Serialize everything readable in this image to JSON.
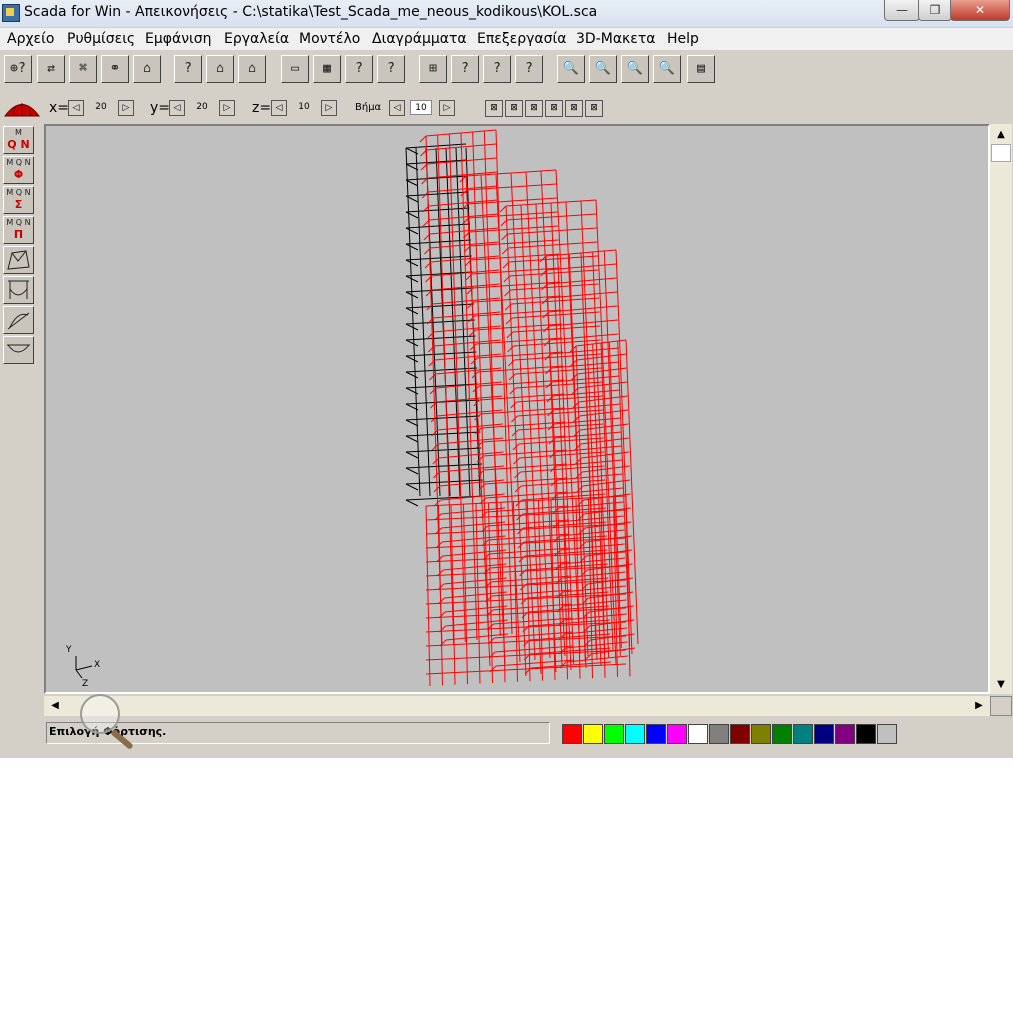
{
  "window": {
    "title": "Scada for Win - Απεικονήσεις - C:\\statika\\Test_Scada_me_neous_kodikous\\KOL.sca",
    "controls": {
      "minimize": "—",
      "restore": "❐",
      "close": "✕"
    }
  },
  "menu": {
    "items": [
      "Αρχείο",
      "Ρυθμίσεις",
      "Εμφάνιση",
      "Εργαλεία",
      "Μοντέλο",
      "Διαγράμματα",
      "Επεξεργασία",
      "3D-Μακετα",
      "Help"
    ]
  },
  "toolbar": {
    "buttons": [
      "⊕?",
      "⇄",
      "⌘",
      "⚭",
      "⌂",
      "?",
      "⌂",
      "⌂",
      "▭",
      "▦",
      "?",
      "?",
      "⊞",
      "?",
      "?",
      "?",
      "🔍",
      "🔍",
      "🔍",
      "🔍",
      "▤"
    ]
  },
  "view_controls": {
    "x_label": "x=",
    "x_value": "20",
    "y_label": "y=",
    "y_value": "20",
    "z_label": "z=",
    "z_value": "10",
    "step_label": "Βήμα",
    "step_value": "10",
    "left_arrow": "◁",
    "right_arrow": "▷",
    "view_buttons": [
      "⊠",
      "⊠",
      "⊠",
      "⊠",
      "⊠",
      "⊠"
    ]
  },
  "left_toolbar": {
    "buttons": [
      {
        "top": "M",
        "bottom": "Q N"
      },
      {
        "top": "M Q N",
        "bottom": "Φ"
      },
      {
        "top": "M Q N",
        "bottom": "Σ"
      },
      {
        "top": "M Q N",
        "bottom": "Π"
      },
      {
        "top": "",
        "bottom": "⟋"
      },
      {
        "top": "",
        "bottom": "⟋"
      },
      {
        "top": "",
        "bottom": "⟋"
      },
      {
        "top": "",
        "bottom": "⌣"
      }
    ]
  },
  "canvas": {
    "background": "#c0c0c0",
    "axes": {
      "y": "Y",
      "x": "X",
      "z": "Z"
    },
    "model_colors": {
      "deformed": "#ff0000",
      "original": "#000000"
    }
  },
  "scrollbars": {
    "up": "▲",
    "down": "▼",
    "left": "◀",
    "right": "▶"
  },
  "status": {
    "text": "Επιλογή Φόρτισης."
  },
  "palette": {
    "colors": [
      "#ff0000",
      "#ffff00",
      "#00ff00",
      "#00ffff",
      "#0000ff",
      "#ff00ff",
      "#ffffff",
      "#808080",
      "#800000",
      "#808000",
      "#008000",
      "#008080",
      "#000080",
      "#800080",
      "#000000",
      "#c0c0c0"
    ]
  }
}
